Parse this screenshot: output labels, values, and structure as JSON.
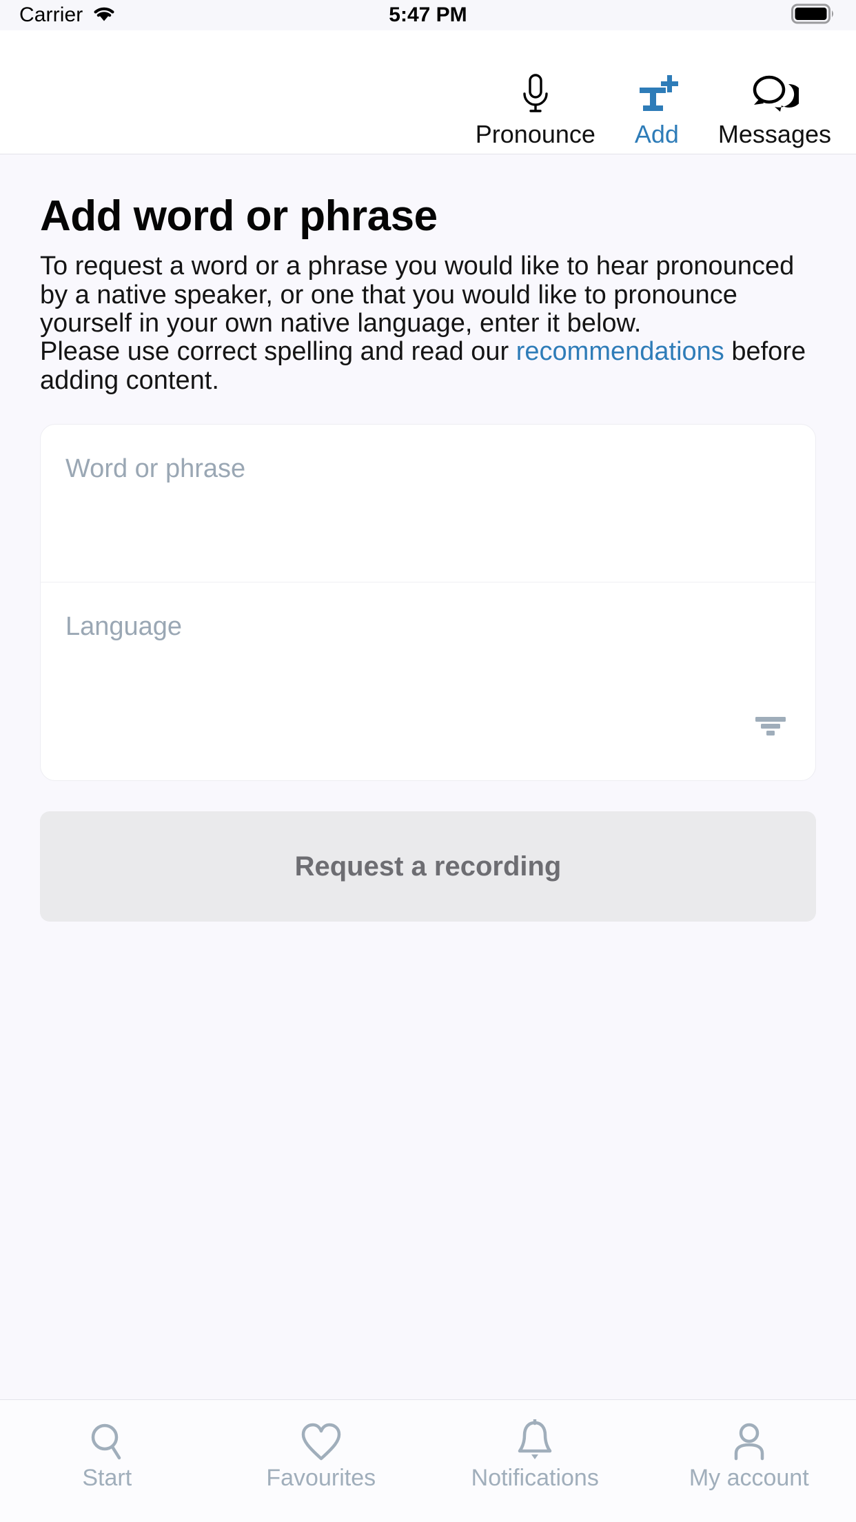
{
  "status_bar": {
    "carrier": "Carrier",
    "time": "5:47 PM",
    "wifi_icon": "wifi-icon",
    "battery_icon": "battery-full-icon"
  },
  "top_nav": {
    "items": [
      {
        "label": "Pronounce",
        "icon": "microphone-icon",
        "active": false
      },
      {
        "label": "Add",
        "icon": "text-plus-icon",
        "active": true
      },
      {
        "label": "Messages",
        "icon": "speech-bubbles-icon",
        "active": false
      }
    ]
  },
  "main": {
    "title": "Add word or phrase",
    "intro_paragraph_1": "To request a word or a phrase you would like to hear pronounced by a native speaker, or one that you would like to pronounce yourself in your own native language, enter it below.",
    "intro_paragraph_2_before": "Please use correct spelling and read our ",
    "intro_link": "recommendations",
    "intro_paragraph_2_after": " before adding content.",
    "form": {
      "word_placeholder": "Word or phrase",
      "word_value": "",
      "language_placeholder": "Language",
      "language_value": "",
      "language_icon": "filter-icon"
    },
    "submit_label": "Request a recording"
  },
  "tab_bar": {
    "items": [
      {
        "label": "Start",
        "icon": "search-icon"
      },
      {
        "label": "Favourites",
        "icon": "heart-icon"
      },
      {
        "label": "Notifications",
        "icon": "bell-icon"
      },
      {
        "label": "My account",
        "icon": "person-icon"
      }
    ]
  },
  "colors": {
    "accent_blue": "#2E7CB8",
    "page_background": "#F9F8FD",
    "placeholder_gray": "#9AA7B4",
    "tab_inactive": "#A0AEBB",
    "button_disabled_bg": "#EAEAEC",
    "button_disabled_text": "#6D6D72"
  }
}
